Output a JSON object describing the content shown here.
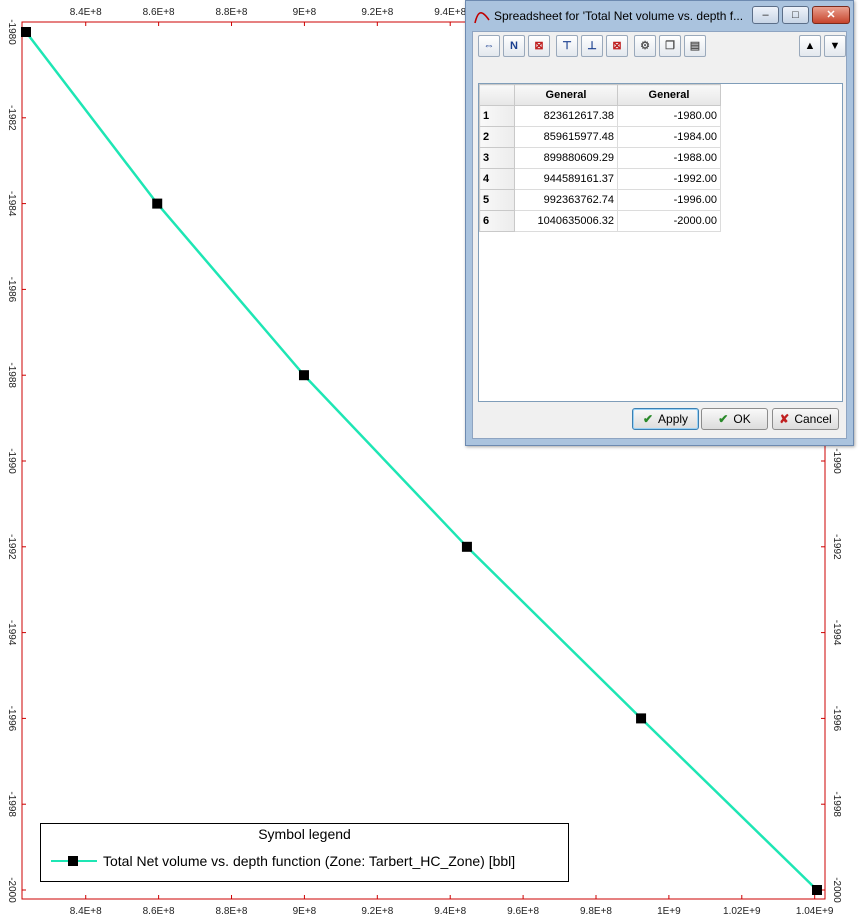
{
  "chart_data": {
    "type": "line",
    "x_top_ticks": [
      "8.4E+8",
      "8.6E+8",
      "8.8E+8",
      "9E+8",
      "9.2E+8",
      "9.4E+8"
    ],
    "x_bottom_ticks": [
      "8.4E+8",
      "8.6E+8",
      "8.8E+8",
      "9E+8",
      "9.2E+8",
      "9.4E+8",
      "9.6E+8",
      "9.8E+8",
      "1E+9",
      "1.02E+9",
      "1.04E+9"
    ],
    "y_left_ticks": [
      "-1980",
      "-1982",
      "-1984",
      "-1986",
      "-1988",
      "-1990",
      "-1992",
      "-1994",
      "-1996",
      "-1998",
      "-2000"
    ],
    "y_right_ticks": [
      "-1990",
      "-1992",
      "-1994",
      "-1996",
      "-1998",
      "-2000"
    ],
    "xlim": [
      823612617.38,
      1040635006.32
    ],
    "ylim": [
      -2000,
      -1980
    ],
    "series": [
      {
        "name": "Total Net volume vs. depth function  (Zone: Tarbert_HC_Zone) [bbl]",
        "x": [
          823612617.38,
          859615977.48,
          899880609.29,
          944589161.37,
          992363762.74,
          1040635006.32
        ],
        "y": [
          -1980,
          -1984,
          -1988,
          -1992,
          -1996,
          -2000
        ],
        "color": "#1ee6b4",
        "marker_color": "#000000"
      }
    ],
    "grid": false,
    "legend_placement": "bottom-left"
  },
  "legend": {
    "title": "Symbol legend",
    "entry": "Total Net volume vs. depth function  (Zone: Tarbert_HC_Zone) [bbl]"
  },
  "dialog": {
    "title": "Spreadsheet for 'Total Net volume vs. depth f...",
    "columns": [
      "General",
      "General"
    ],
    "rows": [
      {
        "index": "1",
        "x": "823612617.38",
        "y": "-1980.00"
      },
      {
        "index": "2",
        "x": "859615977.48",
        "y": "-1984.00"
      },
      {
        "index": "3",
        "x": "899880609.29",
        "y": "-1988.00"
      },
      {
        "index": "4",
        "x": "944589161.37",
        "y": "-1992.00"
      },
      {
        "index": "5",
        "x": "992363762.74",
        "y": "-1996.00"
      },
      {
        "index": "6",
        "x": "1040635006.32",
        "y": "-2000.00"
      }
    ],
    "apply_label": "Apply",
    "ok_label": "OK",
    "cancel_label": "Cancel",
    "toolbar_icons": [
      "append-row-icon",
      "insert-n-rows-icon",
      "delete-row-icon",
      "insert-before-icon",
      "insert-after-icon",
      "delete-rows-icon",
      "settings-icon",
      "copy-icon",
      "paste-icon"
    ]
  },
  "colors": {
    "plot_border": "#cc0000",
    "line": "#1ee6b4",
    "marker": "#000000"
  }
}
